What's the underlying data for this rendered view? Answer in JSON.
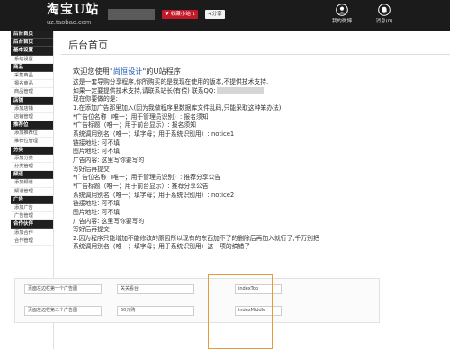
{
  "header": {
    "logo_title": "淘宝U站",
    "logo_subtitle": "uz.taobao.com",
    "fav_badge": "收藏小站 1",
    "share_badge": "+分享",
    "buttons": [
      {
        "label": "我的微博",
        "icon": "user-icon"
      },
      {
        "label": "消息(0)",
        "icon": "bell-icon"
      }
    ]
  },
  "sidebar": {
    "sections": [
      {
        "title": "后台首页",
        "items": []
      },
      {
        "title": "后台首页",
        "items": []
      },
      {
        "title": "基本设置",
        "items": [
          "系统设置"
        ]
      },
      {
        "title": "商品",
        "items": [
          "采集商品",
          "报名商品",
          "商品管理"
        ]
      },
      {
        "title": "店铺",
        "items": [
          "添加店铺",
          "店铺管理"
        ]
      },
      {
        "title": "推荐位",
        "items": [
          "添加推荐位",
          "推荐位管理"
        ]
      },
      {
        "title": "分类",
        "items": [
          "添加分类",
          "分类管理"
        ]
      },
      {
        "title": "频道",
        "items": [
          "添加频道",
          "频道管理"
        ]
      },
      {
        "title": "广告",
        "items": [
          "添加广告",
          "广告管理"
        ]
      },
      {
        "title": "合作伙伴",
        "items": [
          "添加合作",
          "合作管理"
        ]
      }
    ]
  },
  "main": {
    "title": "后台首页",
    "welcome_prefix": "欢迎您使用\"",
    "welcome_brand": "尚恒设计",
    "welcome_suffix": "\"的U站程序",
    "contact_prefix": "如果一定要提供技术支持,请联系站长(有偿) 联系QQ:",
    "lines": [
      "这是一套导购分享程序,你所购买的是我现在使用的版本,不提供技术支持.",
      "现在你要做的是:",
      "1.在添加广告那里加入(因为我做程序里数据库文件乱码,只能采取这种笨办法)",
      "*广告位名称（唯一；用于管理员识别）: 报名须知",
      "*广告标题（唯一；用于前台显示）: 报名须知",
      "系统调用别名（唯一；填字母；用于系统识别用）: notice1",
      "链接地址: 可不填",
      "图片地址: 可不填",
      "广告内容: 这里写你要写的",
      "写好后再提交",
      "*广告位名称（唯一；用于管理员识别）: 推荐分享公告",
      "*广告标题（唯一；用于前台显示）: 推荐分享公告",
      "系统调用别名（唯一；填字母；用于系统识别用）: notice2",
      "链接地址: 可不填",
      "图片地址: 可不填",
      "广告内容: 这里写你要写的",
      "写好后再提交",
      "2.因为程序只能增加不能修改的原因所以现有的东西加不了的删除后再加入就行了,千万别把",
      "系统调用别名（唯一；填字母；用于系统识别用）这一项的搞错了"
    ]
  },
  "form_rows": [
    {
      "name": "页面左边栏第一个广告图",
      "title": "关关看台",
      "alias": "indexTop"
    },
    {
      "name": "页面左边栏第二个广告图",
      "title": "50元购",
      "alias": "indexMiddle"
    }
  ],
  "colors": {
    "header_bg": "#1b1b1b",
    "section_bg": "#1f1f1f",
    "brand_link": "#1a56b5",
    "badge_red": "#c2192b",
    "highlight": "#e79a3b"
  }
}
